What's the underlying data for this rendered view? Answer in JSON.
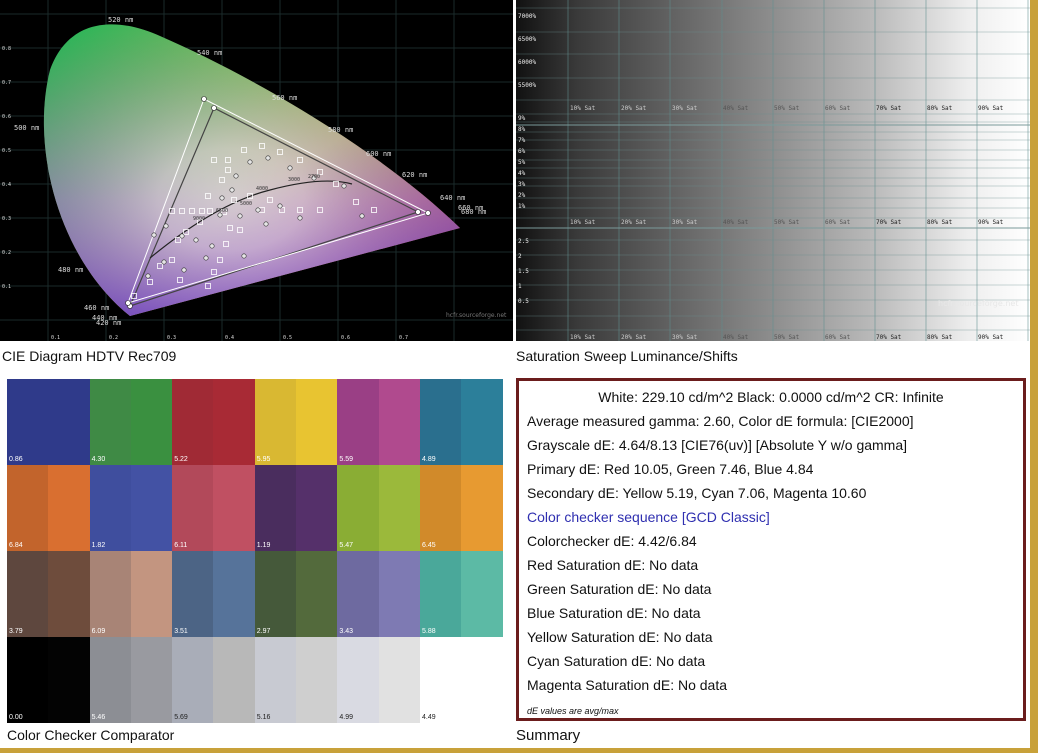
{
  "captions": {
    "cie": "CIE Diagram HDTV Rec709",
    "sweep": "Saturation Sweep Luminance/Shifts",
    "checker": "Color Checker Comparator",
    "summary": "Summary"
  },
  "summary": {
    "rows": [
      "White: 229.10 cd/m^2 Black: 0.0000 cd/m^2 CR: Infinite",
      "Average measured gamma: 2.60, Color dE formula:  [CIE2000]",
      "Grayscale dE: 4.64/8.13 [CIE76(uv)] [Absolute Y w/o gamma]",
      "Primary dE:   Red 10.05, Green 7.46, Blue 4.84",
      "Secondary dE: Yellow 5.19, Cyan 7.06, Magenta 10.60",
      "Color checker sequence [GCD Classic]",
      "Colorchecker dE:        4.42/6.84",
      "Red Saturation dE:       No data",
      "Green Saturation dE:     No data",
      "Blue Saturation dE:      No data",
      "Yellow Saturation dE:    No data",
      "Cyan Saturation dE:      No data",
      "Magenta Saturation dE: No data"
    ],
    "footnote": "dE values are avg/max",
    "link_color": "#2f2fb0",
    "border_color": "#6b1d1d"
  },
  "chart_data": [
    {
      "type": "scatter",
      "title": "",
      "gamut_label": "HDTV Rec709",
      "wavelength_labels": [
        "520 nm",
        "540 nm",
        "560 nm",
        "580 nm",
        "600 nm",
        "620 nm",
        "640 nm",
        "660 nm",
        "680 nm",
        "500 nm",
        "480 nm",
        "460 nm",
        "440 nm",
        "420 nm"
      ],
      "x_ticks": [
        "0.1",
        "0.2",
        "0.3",
        "0.4",
        "0.5",
        "0.6",
        "0.7"
      ],
      "y_ticks": [
        "0.1",
        "0.2",
        "0.3",
        "0.4",
        "0.5",
        "0.6",
        "0.7",
        "0.8"
      ],
      "watermark": "hcfr.sourceforge.net",
      "rec709_primaries": [
        [
          0.64,
          0.33
        ],
        [
          0.3,
          0.6
        ],
        [
          0.15,
          0.06
        ]
      ],
      "measured_primaries": [
        [
          0.655,
          0.325
        ],
        [
          0.285,
          0.645
        ],
        [
          0.148,
          0.053
        ]
      ],
      "blackbody_labels": [
        "9000",
        "6500",
        "5000",
        "4000",
        "3000",
        "2700"
      ]
    },
    {
      "type": "heatmap",
      "title": "",
      "top_luminance_labels": [
        "7000%",
        "6500%",
        "6000%",
        "5500%"
      ],
      "luminance_labels": [
        "9%",
        "8%",
        "7%",
        "6%",
        "5%",
        "4%",
        "3%",
        "2%",
        "1%"
      ],
      "bottom_labels": [
        "2.5",
        "2",
        "1.5",
        "1",
        "0.5"
      ],
      "sat_labels": [
        "10% Sat",
        "20% Sat",
        "30% Sat",
        "40% Sat",
        "50% Sat",
        "60% Sat",
        "70% Sat",
        "80% Sat",
        "90% Sat"
      ],
      "watermark": "hcfr.sourceforge.net"
    },
    {
      "type": "table",
      "title": "",
      "patches": [
        {
          "left": "#2f3a8a",
          "right": "#2f3a8a",
          "label": "0.86"
        },
        {
          "left": "#3f8a45",
          "right": "#3a9040",
          "label": "4.30"
        },
        {
          "left": "#a02a35",
          "right": "#a82a35",
          "label": "5.22"
        },
        {
          "left": "#d9b832",
          "right": "#e8c431",
          "label": "5.95"
        },
        {
          "left": "#9a3f85",
          "right": "#b04a8e",
          "label": "5.59"
        },
        {
          "left": "#2a6f8e",
          "right": "#2c7f9a",
          "label": "4.89"
        },
        {
          "left": "#c2642c",
          "right": "#d96f30",
          "label": "6.84"
        },
        {
          "left": "#3f4e9e",
          "right": "#4352a4",
          "label": "1.82"
        },
        {
          "left": "#b2495a",
          "right": "#c05062",
          "label": "6.11"
        },
        {
          "left": "#4a2d5e",
          "right": "#55306a",
          "label": "1.19"
        },
        {
          "left": "#8aad34",
          "right": "#9bb93b",
          "label": "5.47"
        },
        {
          "left": "#d18a2a",
          "right": "#e79a31",
          "label": "6.45"
        },
        {
          "left": "#5e473e",
          "right": "#6e4c3c",
          "label": "3.79"
        },
        {
          "left": "#a88476",
          "right": "#c39580",
          "label": "6.09"
        },
        {
          "left": "#4c6485",
          "right": "#56739a",
          "label": "3.51"
        },
        {
          "left": "#45593a",
          "right": "#536a3c",
          "label": "2.97"
        },
        {
          "left": "#6e6aa0",
          "right": "#7e7ab3",
          "label": "3.43"
        },
        {
          "left": "#4aa89a",
          "right": "#5cbaa5",
          "label": "5.88"
        },
        {
          "left": "#000000",
          "right": "#030303",
          "label": "0.00"
        },
        {
          "left": "#8c8e94",
          "right": "#999aa0",
          "label": "5.46"
        },
        {
          "left": "#a9adb8",
          "right": "#b8b8b8",
          "label": "5.69"
        },
        {
          "left": "#c8cad2",
          "right": "#cfcfcf",
          "label": "5.16"
        },
        {
          "left": "#d9dae2",
          "right": "#e1e1e1",
          "label": "4.99"
        },
        {
          "left": "#ffffff",
          "right": "#ffffff",
          "label": "4.49"
        }
      ]
    }
  ]
}
